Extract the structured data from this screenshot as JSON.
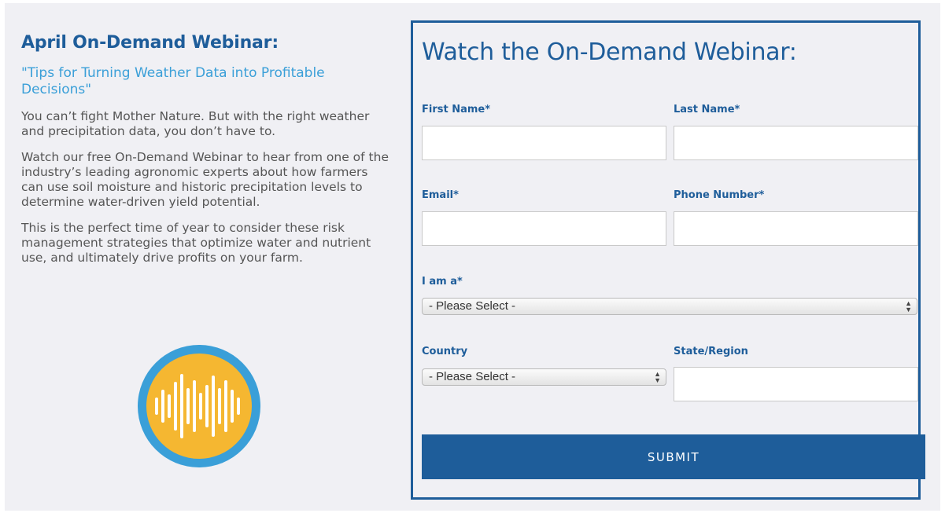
{
  "promo": {
    "heading": "April On-Demand Webinar:",
    "subtitle": "\"Tips for Turning Weather Data into Profitable Decisions\"",
    "paragraphs": [
      "You can’t fight Mother Nature. But with the right weather and precipitation data, you don’t have to.",
      "Watch our free On-Demand Webinar to hear from one of the industry’s leading agronomic experts about how farmers can use soil moisture and historic precipitation levels to determine water-driven yield potential.",
      "This is the perfect time of year to consider these risk management strategies that optimize water and nutrient use, and ultimately drive profits on your farm."
    ],
    "logo_icon": "audio-waveform-icon"
  },
  "form": {
    "title": "Watch the On-Demand Webinar:",
    "fields": {
      "first_name": {
        "label": "First Name*",
        "value": "",
        "placeholder": ""
      },
      "last_name": {
        "label": "Last Name*",
        "value": "",
        "placeholder": ""
      },
      "email": {
        "label": "Email*",
        "value": "",
        "placeholder": ""
      },
      "phone": {
        "label": "Phone Number*",
        "value": "",
        "placeholder": ""
      },
      "i_am_a": {
        "label": "I am a*",
        "selected": "- Please Select -"
      },
      "country": {
        "label": "Country",
        "selected": "- Please Select -"
      },
      "state_region": {
        "label": "State/Region",
        "value": "",
        "placeholder": ""
      }
    },
    "submit_label": "SUBMIT"
  },
  "colors": {
    "brand_blue": "#1e5d9a",
    "accent_blue": "#3a9fd8",
    "logo_ring": "#3a9fd8",
    "logo_fill": "#f5b731",
    "background": "#f0f0f4"
  }
}
